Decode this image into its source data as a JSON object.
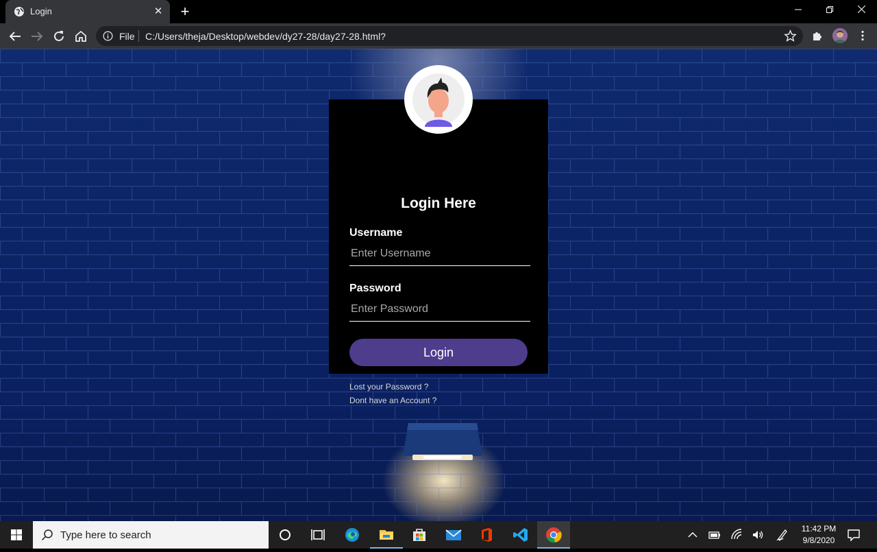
{
  "browser": {
    "tab_title": "Login",
    "tab_close": "✕",
    "new_tab": "+",
    "file_label": "File",
    "url": "C:/Users/theja/Desktop/webdev/dy27-28/day27-28.html?"
  },
  "login": {
    "heading": "Login Here",
    "username_label": "Username",
    "username_placeholder": "Enter Username",
    "password_label": "Password",
    "password_placeholder": "Enter Password",
    "button_label": "Login",
    "lost_password": "Lost your Password ?",
    "no_account": "Dont have an Account ?"
  },
  "taskbar": {
    "search_placeholder": "Type here to search",
    "time": "11:42 PM",
    "date": "9/8/2020"
  },
  "colors": {
    "button": "#4e3c8c",
    "wall": "#0b2465",
    "box": "#000000"
  }
}
